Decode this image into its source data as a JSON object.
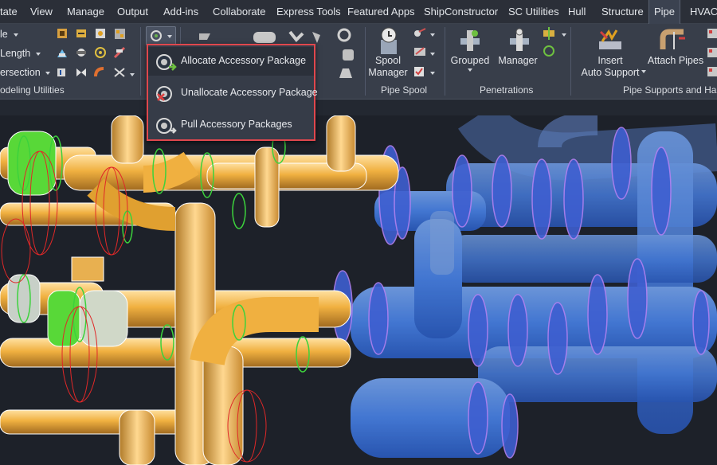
{
  "tabs": [
    "tate",
    "View",
    "Manage",
    "Output",
    "Add-ins",
    "Collaborate",
    "Express Tools",
    "Featured Apps",
    "ShipConstructor",
    "SC Utilities",
    "Hull",
    "Structure",
    "Pipe",
    "HVAC"
  ],
  "active_tab": "Pipe",
  "ribbon": {
    "modeling": {
      "items": [
        "le",
        "Length",
        "ersection"
      ],
      "panel_label": "odeling Utilities"
    },
    "spool": {
      "button_line1": "Spool",
      "button_line2": "Manager",
      "panel_label": "Pipe Spool"
    },
    "penetrations": {
      "grouped_label": "Grouped",
      "manager_label": "Manager",
      "panel_label": "Penetrations"
    },
    "supports": {
      "insert_line1": "Insert",
      "insert_line2": "Auto Support",
      "attach_label": "Attach Pipes",
      "panel_label": "Pipe Supports and Ha"
    }
  },
  "dropdown": {
    "items": [
      {
        "label": "Allocate Accessory Package",
        "icon": "allocate-package-icon"
      },
      {
        "label": "Unallocate Accessory Package",
        "icon": "unallocate-package-icon"
      },
      {
        "label": "Pull Accessory Packages",
        "icon": "pull-packages-icon"
      }
    ],
    "highlighted_index": 0
  },
  "colors": {
    "ribbon_bg": "#383e4a",
    "tab_bar_bg": "#2b2f38",
    "viewport_bg": "#1d2129",
    "pipe_orange": "#f0b040",
    "pipe_blue": "#4a86f0",
    "flange_green": "#3cd23c",
    "highlight_border": "#e0474d"
  }
}
